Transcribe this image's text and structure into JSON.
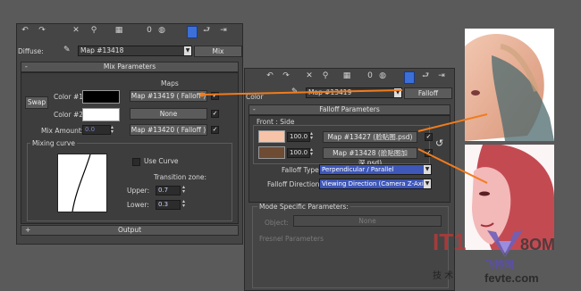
{
  "colors": {
    "orange_line": "#f07c1e",
    "bg": "#5a5a5a",
    "panel": "#444444"
  },
  "left": {
    "toolbar_icons": [
      "undo-icon",
      "redo-icon",
      "close-icon",
      "link-icon",
      "material-icon",
      "zero-icon",
      "sphere-icon",
      "grid-icon",
      "go-parent-icon",
      "go-forward-icon"
    ],
    "diffuse_label": "Diffuse:",
    "diffuse_map": "Map #13418",
    "diffuse_type": "Mix",
    "rollout_title": "Mix Parameters",
    "maps_header": "Maps",
    "swap_label": "Swap",
    "color1_label": "Color #1",
    "color1_map": "Map #13419  ( Falloff )",
    "color2_label": "Color #2",
    "color2_map": "None",
    "mix_amount_label": "Mix Amount:",
    "mix_amount_value": "0.0",
    "mix_amount_map": "Map #13420  ( Falloff )",
    "mixing_curve_label": "Mixing curve",
    "use_curve_label": "Use Curve",
    "transition_label": "Transition zone:",
    "upper_label": "Upper:",
    "upper_value": "0.7",
    "lower_label": "Lower:",
    "lower_value": "0.3",
    "output_label": "Output",
    "output_sign": "+",
    "mix_sign": "-"
  },
  "right": {
    "toolbar_icons": [
      "undo-icon",
      "redo-icon",
      "close-icon",
      "link-icon",
      "material-icon",
      "zero-icon",
      "sphere-icon",
      "grid-icon",
      "go-parent-icon",
      "go-forward-icon"
    ],
    "color_label": "Color",
    "map_name": "Map #13419",
    "map_type": "Falloff",
    "rollout_title": "Falloff Parameters",
    "rollout_sign": "-",
    "front_side_label": "Front : Side",
    "val1": "100.0",
    "map1": "Map #13427 (脸贴图.psd)",
    "val2": "100.0",
    "map2": "Map #13428 (脸贴图加深.psd)",
    "falloff_type_label": "Falloff Type:",
    "falloff_type_value": "Perpendicular / Parallel",
    "falloff_dir_label": "Falloff Direction:",
    "falloff_dir_value": "Viewing Direction (Camera Z-Axis)",
    "mode_label": "Mode Specific Parameters:",
    "object_label": "Object:",
    "object_value": "None",
    "fresnel_label": "Fresnel Parameters"
  },
  "watermark": {
    "brand": "IT1",
    "brand_suffix": "8OM",
    "chinese": "技  术",
    "feiteng": "飞特网",
    "url": "fevte.com"
  }
}
